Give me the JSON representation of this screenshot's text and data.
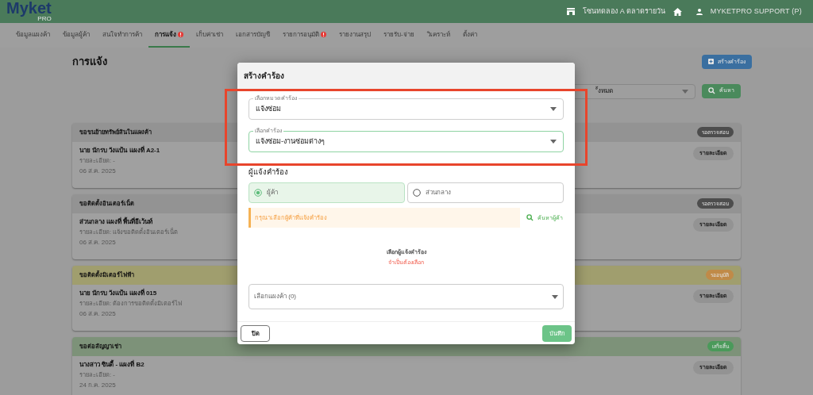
{
  "header": {
    "logo": "Myket",
    "logo_sub": "PRO",
    "market": "โซนทดลอง A ตลาดรายวัน",
    "user": "MYKETPRO SUPPORT (P)"
  },
  "tabs": [
    {
      "label": "ข้อมูลแผงค้า",
      "selected": false,
      "alert": false
    },
    {
      "label": "ข้อมูลผู้ค้า",
      "selected": false,
      "alert": false
    },
    {
      "label": "สนใจทำการค้า",
      "selected": false,
      "alert": false
    },
    {
      "label": "การแจ้ง",
      "selected": true,
      "alert": true
    },
    {
      "label": "เก็บค่าเช่า",
      "selected": false,
      "alert": false
    },
    {
      "label": "เอกสารบัญชี",
      "selected": false,
      "alert": false
    },
    {
      "label": "รายการอนุมัติ",
      "selected": false,
      "alert": true
    },
    {
      "label": "รายงานสรุป",
      "selected": false,
      "alert": false
    },
    {
      "label": "รายรับ-จ่าย",
      "selected": false,
      "alert": false
    },
    {
      "label": "วิเคราะห์",
      "selected": false,
      "alert": false
    },
    {
      "label": "ตั้งค่า",
      "selected": false,
      "alert": false
    }
  ],
  "page_title": "การแจ้ง",
  "create_button": "สร้างคำร้อง",
  "filter": {
    "value": "ั้งหมด",
    "search_button": "ค้นหา"
  },
  "cards": [
    {
      "title": "ขอขนย้ายทรัพย์สินในแผงค้า",
      "color": "#939393",
      "status": {
        "label": "รอตรวจสอบ",
        "color": "#4d4d4d"
      },
      "name": "นาย นักรบ วังแป้น แผงที่ A2-1",
      "detail": "รายละเอียด: -",
      "date": "06 ส.ค. 2025",
      "button": "รายละเอียด"
    },
    {
      "title": "ขอติดตั้งอินเตอร์เน็ต",
      "color": "#939393",
      "status": {
        "label": "รอตรวจสอบ",
        "color": "#4d4d4d"
      },
      "name": "ส่วนกลาง แผงที่ พื้นที่อีเว้นท์",
      "detail": "รายละเอียด: แจ้งขอติดตั้งอินเตอร์เน็ต",
      "date": "06 ส.ค. 2025",
      "button": "รายละเอียด"
    },
    {
      "title": "ขอติดตั้งมิเตอร์ไฟฟ้า",
      "color": "#a09e6e",
      "status": {
        "label": "รออนุมัติ",
        "color": "#c08a48"
      },
      "name": "นาย นักรบ วังแป้น แผงที่ 015",
      "detail": "รายละเอียด: ต้องการขอติดตั้งมิเตอร์ไฟ",
      "date": "06 ส.ค. 2025",
      "button": "รายละเอียด"
    },
    {
      "title": "ขอต่อสัญญาเช่า",
      "color": "#7d9279",
      "status": {
        "label": "เสร็จสิ้น",
        "color": "#4a9a5a"
      },
      "name": "นางสาว ซินดี้ - แผงที่ B2",
      "detail": "รายละเอียด: -",
      "date": "24 ก.ค. 2025",
      "button": "รายละเอียด"
    }
  ],
  "dialog": {
    "title": "สร้างคำร้อง",
    "category": {
      "label": "เลือกหมวดคำร้อง",
      "value": "แจ้งซ่อม"
    },
    "request": {
      "label": "เลือกคำร้อง",
      "value": "แจ้งซ่อม-งานซ่อมต่างๆ"
    },
    "requester_heading": "ผู้แจ้งคำร้อง",
    "requester_options": [
      {
        "label": "ผู้ค้า",
        "selected": true
      },
      {
        "label": "ส่วนกลาง",
        "selected": false
      }
    ],
    "warning": "กรุณาเลือกผู้ค้าที่แจ้งคำร้อง",
    "search_vendor": "ค้นหาผู้ค้า",
    "empty_title": "เลือกผู้แจ้งคำร้อง",
    "empty_required": "จำเป็นต้องเลือก",
    "stall_select": {
      "placeholder": "เลือกแผงค้า (0)"
    },
    "close_button": "ปิด",
    "save_button": "บันทึก"
  }
}
